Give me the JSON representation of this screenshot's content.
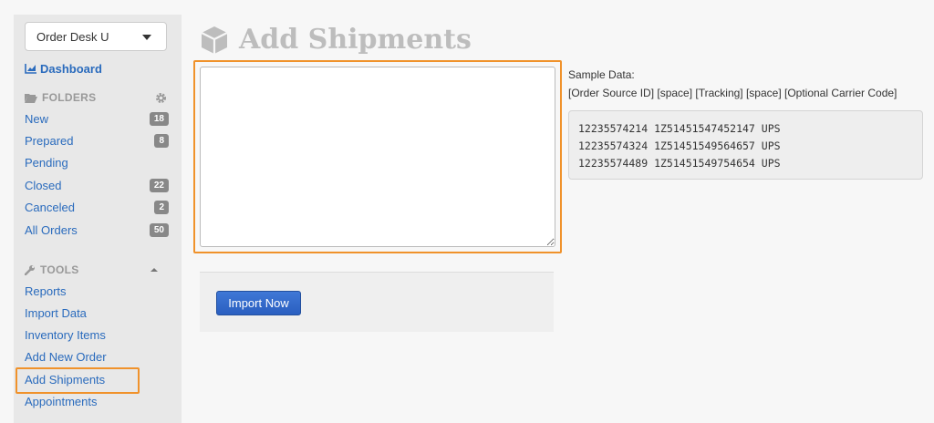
{
  "sidebar": {
    "store_selector": "Order Desk U",
    "dashboard": "Dashboard",
    "folders_heading": "FOLDERS",
    "folders": [
      {
        "label": "New",
        "count": "18"
      },
      {
        "label": "Prepared",
        "count": "8"
      },
      {
        "label": "Pending",
        "count": ""
      },
      {
        "label": "Closed",
        "count": "22"
      },
      {
        "label": "Canceled",
        "count": "2"
      },
      {
        "label": "All Orders",
        "count": "50"
      }
    ],
    "tools_heading": "TOOLS",
    "tools": [
      {
        "label": "Reports"
      },
      {
        "label": "Import Data"
      },
      {
        "label": "Inventory Items"
      },
      {
        "label": "Add New Order"
      },
      {
        "label": "Add Shipments"
      },
      {
        "label": "Appointments"
      }
    ]
  },
  "main": {
    "title": "Add Shipments",
    "textarea_value": "",
    "import_button": "Import Now",
    "sample_title": "Sample Data:",
    "sample_format": "[Order Source ID] [space] [Tracking] [space] [Optional Carrier Code]",
    "sample_lines": [
      "12235574214 1Z51451547452147 UPS",
      "12235574324 1Z51451549564657 UPS",
      "12235574489 1Z51451549754654 UPS"
    ]
  },
  "colors": {
    "link": "#2a6bbd",
    "highlight": "#f0922b",
    "button": "#2a5fc0"
  }
}
